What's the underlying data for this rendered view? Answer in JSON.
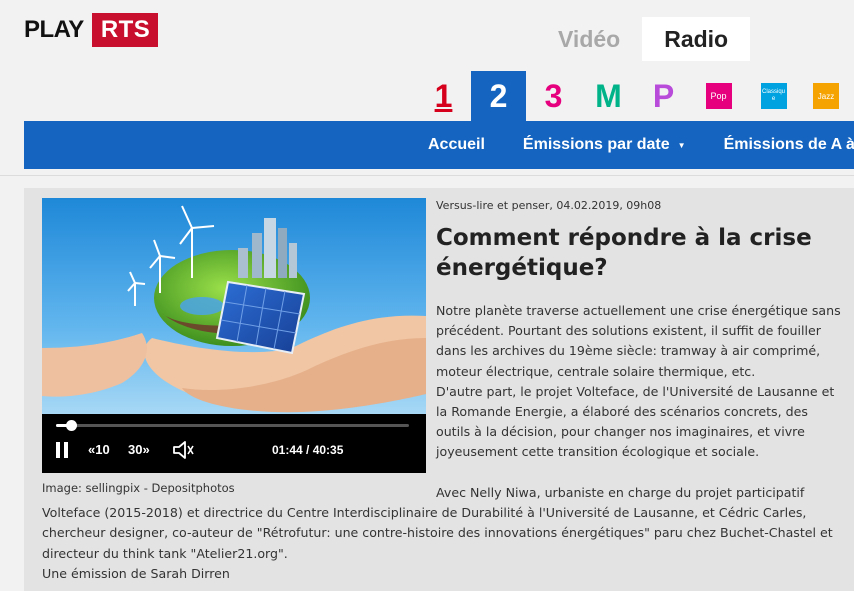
{
  "header": {
    "logo_play": "PLAY",
    "logo_rts": "RTS",
    "media_tabs": [
      {
        "label": "Vidéo",
        "active": false
      },
      {
        "label": "Radio",
        "active": true
      }
    ],
    "channels": [
      {
        "label": "1",
        "color": "#d6001c"
      },
      {
        "label": "2",
        "color": "#ffffff",
        "active": true
      },
      {
        "label": "3",
        "color": "#e6007e"
      },
      {
        "label": "M",
        "color": "#00b388"
      },
      {
        "label": "P",
        "color": "#b84bd9"
      },
      {
        "label": "Pop",
        "color": "#e6007e"
      },
      {
        "label": "Classique",
        "color": "#00a3e0"
      },
      {
        "label": "Jazz",
        "color": "#f5a300"
      }
    ]
  },
  "nav": {
    "items": [
      "Accueil",
      "Émissions par date",
      "Émissions de A à Z"
    ]
  },
  "article": {
    "meta": "Versus-lire et penser, 04.02.2019, 09h08",
    "title": "Comment répondre à la crise énergétique?",
    "paragraph1": "Notre planète traverse actuellement une crise énergétique sans précédent. Pourtant des solutions existent, il suffit de fouiller dans les archives du 19ème siècle: tramway à air comprimé, moteur électrique, centrale solaire thermique, etc.",
    "paragraph2": "D'autre part, le projet Volteface, de l'Université de Lausanne et la Romande Energie, a élaboré des scénarios concrets, des outils à la décision, pour changer nos imaginaires, et vivre joyeusement cette transition écologique et sociale.",
    "paragraph3_start": "Avec Nelly Niwa, urbaniste en charge du projet participatif",
    "paragraph3_rest": "Volteface (2015-2018) et directrice du Centre Interdisciplinaire de Durabilité à l'Université de Lausanne, et Cédric Carles, chercheur designer, co-auteur de \"Rétrofutur: une contre-histoire des innovations énergétiques\" paru chez Buchet-Chastel et directeur du think tank \"Atelier21.org\".",
    "credit": "Une émission de Sarah Dirren"
  },
  "player": {
    "image_caption": "Image: sellingpix - Depositphotos",
    "rewind_label": "10",
    "forward_label": "30",
    "current_time": "01:44",
    "duration": "40:35",
    "time_display": "01:44 / 40:35",
    "progress": 0.043
  }
}
